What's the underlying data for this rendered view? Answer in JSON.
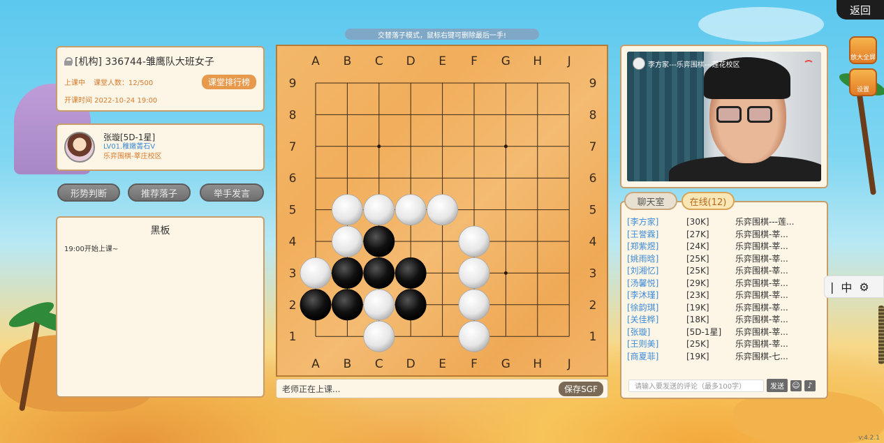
{
  "header": {
    "return_label": "返回",
    "notice": "交替落子模式，鼠标右键可删除最后一手!"
  },
  "class_info": {
    "title": "[机构] 336744-雏鹰队大班女子",
    "status": "上课中",
    "count": "课堂人数：12/500",
    "rank_button": "课堂排行榜",
    "start_time": "开课时间 2022-10-24 19:00"
  },
  "teacher": {
    "name": "张璇[5D-1星]",
    "level": "LV01.稚嫩菁石V",
    "school": "乐弈围棋-莘庄校区"
  },
  "actions": [
    "形势判断",
    "推荐落子",
    "举手发言"
  ],
  "blackboard": {
    "title": "黑板",
    "content": "19:00开始上课~"
  },
  "board": {
    "size": 9,
    "columns": [
      "A",
      "B",
      "C",
      "D",
      "E",
      "F",
      "G",
      "H",
      "J"
    ],
    "rows": [
      "9",
      "8",
      "7",
      "6",
      "5",
      "4",
      "3",
      "2",
      "1"
    ],
    "star_points": [
      [
        "C",
        7
      ],
      [
        "G",
        7
      ],
      [
        "G",
        3
      ]
    ],
    "stones": [
      {
        "color": "white",
        "pos": [
          "B",
          5
        ]
      },
      {
        "color": "white",
        "pos": [
          "C",
          5
        ]
      },
      {
        "color": "white",
        "pos": [
          "D",
          5
        ]
      },
      {
        "color": "white",
        "pos": [
          "E",
          5
        ]
      },
      {
        "color": "white",
        "pos": [
          "B",
          4
        ]
      },
      {
        "color": "black",
        "pos": [
          "C",
          4
        ]
      },
      {
        "color": "white",
        "pos": [
          "F",
          4
        ]
      },
      {
        "color": "white",
        "pos": [
          "A",
          3
        ]
      },
      {
        "color": "black",
        "pos": [
          "B",
          3
        ]
      },
      {
        "color": "black",
        "pos": [
          "C",
          3
        ]
      },
      {
        "color": "black",
        "pos": [
          "D",
          3
        ]
      },
      {
        "color": "white",
        "pos": [
          "F",
          3
        ]
      },
      {
        "color": "black",
        "pos": [
          "A",
          2
        ]
      },
      {
        "color": "black",
        "pos": [
          "B",
          2
        ]
      },
      {
        "color": "white",
        "pos": [
          "C",
          2
        ]
      },
      {
        "color": "black",
        "pos": [
          "D",
          2
        ]
      },
      {
        "color": "white",
        "pos": [
          "F",
          2
        ]
      },
      {
        "color": "white",
        "pos": [
          "C",
          1
        ]
      },
      {
        "color": "white",
        "pos": [
          "F",
          1
        ]
      }
    ]
  },
  "status_bar": {
    "text": "老师正在上课...",
    "save_label": "保存SGF"
  },
  "video": {
    "label": "李方家---乐弈围棋---莲花校区"
  },
  "tabs": {
    "chat": "聊天室",
    "online": "在线(12)"
  },
  "online_users": [
    {
      "name": "[李方家]",
      "rank": "[30K]",
      "school": "乐弈围棋---莲..."
    },
    {
      "name": "[王誉霖]",
      "rank": "[27K]",
      "school": "乐弈围棋-莘..."
    },
    {
      "name": "[郑紫煜]",
      "rank": "[24K]",
      "school": "乐弈围棋-莘..."
    },
    {
      "name": "[姚雨晗]",
      "rank": "[25K]",
      "school": "乐弈围棋-莘..."
    },
    {
      "name": "[刘湘忆]",
      "rank": "[25K]",
      "school": "乐弈围棋-莘..."
    },
    {
      "name": "[汤馨悦]",
      "rank": "[29K]",
      "school": "乐弈围棋-莘..."
    },
    {
      "name": "[李沐瑾]",
      "rank": "[23K]",
      "school": "乐弈围棋-莘..."
    },
    {
      "name": "[徐韵琪]",
      "rank": "[19K]",
      "school": "乐弈围棋-莘..."
    },
    {
      "name": "[关佳桦]",
      "rank": "[18K]",
      "school": "乐弈围棋-莘..."
    },
    {
      "name": "[张璇]",
      "rank": "[5D-1星]",
      "school": "乐弈围棋-莘..."
    },
    {
      "name": "[王则美]",
      "rank": "[25K]",
      "school": "乐弈围棋-莘..."
    },
    {
      "name": "[商夏菲]",
      "rank": "[19K]",
      "school": "乐弈围棋-七..."
    }
  ],
  "chat_input": {
    "placeholder": "请输入要发送的评论（最多100字）",
    "send_label": "发送"
  },
  "ime": {
    "mode": "中"
  },
  "side_icons": {
    "fullscreen": "放大全屏",
    "settings": "设置"
  },
  "version": "v:4.2.1"
}
